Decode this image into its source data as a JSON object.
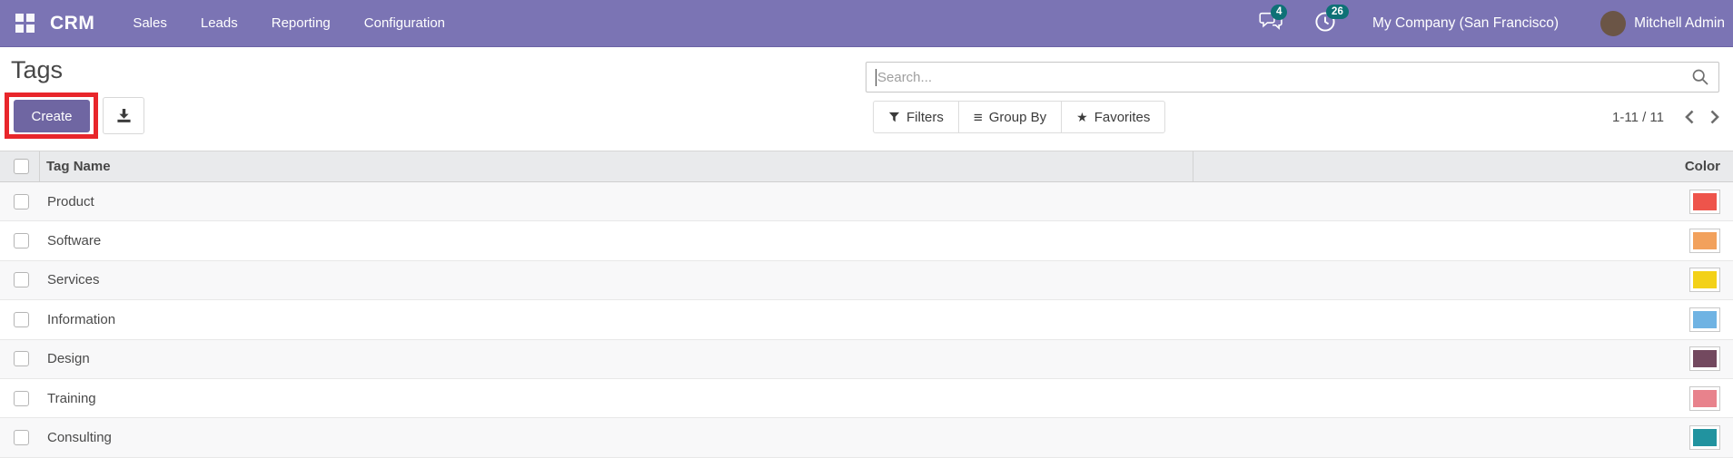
{
  "navbar": {
    "app_name": "CRM",
    "menus": [
      "Sales",
      "Leads",
      "Reporting",
      "Configuration"
    ],
    "messages_badge": "4",
    "activities_badge": "26",
    "company": "My Company (San Francisco)",
    "user": "Mitchell Admin"
  },
  "page": {
    "title": "Tags",
    "search_placeholder": "Search...",
    "toolbar": {
      "create": "Create",
      "filters": "Filters",
      "group_by": "Group By",
      "group_by_glyph": "≡",
      "favorites": "Favorites",
      "favorites_glyph": "★",
      "pager": "1-11 / 11"
    },
    "table": {
      "col_tag_name": "Tag Name",
      "col_color": "Color",
      "rows": [
        {
          "name": "Product",
          "color": "#ee544b"
        },
        {
          "name": "Software",
          "color": "#f2a15c"
        },
        {
          "name": "Services",
          "color": "#f3d118"
        },
        {
          "name": "Information",
          "color": "#6fb3e3"
        },
        {
          "name": "Design",
          "color": "#73495f"
        },
        {
          "name": "Training",
          "color": "#e8828c"
        },
        {
          "name": "Consulting",
          "color": "#21939f"
        }
      ]
    }
  },
  "theme": {
    "navbar_bg": "#7b74b4",
    "badge_bg": "#0e7176",
    "primary_button_bg": "#6f66a2",
    "annotation_border": "#e8262b"
  }
}
